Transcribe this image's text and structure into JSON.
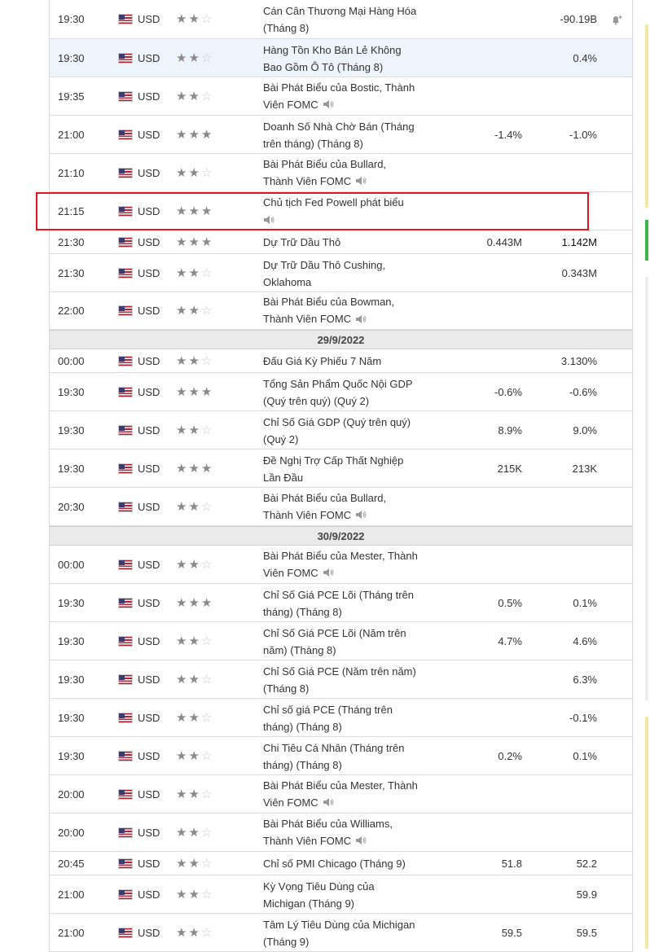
{
  "colors": {
    "highlight_border": "#e0191f",
    "date_row_bg": "#eaeaea",
    "highlight_row_bg": "#eef4fb"
  },
  "rows": [
    {
      "type": "event",
      "time": "19:30",
      "currency": "USD",
      "stars": 2,
      "event": "Cán Cân Thương Mại Hàng Hóa (Tháng 8)",
      "actual": "",
      "forecast": "-90.19B",
      "bell": true,
      "speaker": false
    },
    {
      "type": "event",
      "time": "19:30",
      "currency": "USD",
      "stars": 2,
      "event": "Hàng Tồn Kho Bán Lẻ Không Bao Gồm Ô Tô (Tháng 8)",
      "actual": "",
      "forecast": "0.4%",
      "highlight": true,
      "speaker": false
    },
    {
      "type": "event",
      "time": "19:35",
      "currency": "USD",
      "stars": 2,
      "event": "Bài Phát Biểu của Bostic, Thành Viên FOMC",
      "actual": "",
      "forecast": "",
      "speaker": true
    },
    {
      "type": "event",
      "time": "21:00",
      "currency": "USD",
      "stars": 3,
      "event": "Doanh Số Nhà Chờ Bán (Tháng trên tháng) (Tháng 8)",
      "actual": "-1.4%",
      "forecast": "-1.0%",
      "speaker": false
    },
    {
      "type": "event",
      "time": "21:10",
      "currency": "USD",
      "stars": 2,
      "event": "Bài Phát Biểu của Bullard, Thành Viên FOMC",
      "actual": "",
      "forecast": "",
      "speaker": true
    },
    {
      "type": "event",
      "time": "21:15",
      "currency": "USD",
      "stars": 3,
      "event": "Chủ tịch Fed Powell phát biểu",
      "actual": "",
      "forecast": "",
      "speaker": true,
      "speaker_newline": true
    },
    {
      "type": "event",
      "time": "21:30",
      "currency": "USD",
      "stars": 3,
      "event": "Dự Trữ Dầu Thô",
      "actual": "0.443M",
      "forecast": "1.142M",
      "speaker": false,
      "bold_forecast": true
    },
    {
      "type": "event",
      "time": "21:30",
      "currency": "USD",
      "stars": 2,
      "event": "Dự Trữ Dầu Thô Cushing, Oklahoma",
      "actual": "",
      "forecast": "0.343M",
      "speaker": false
    },
    {
      "type": "event",
      "time": "22:00",
      "currency": "USD",
      "stars": 2,
      "event": "Bài Phát Biểu của Bowman, Thành Viên FOMC",
      "actual": "",
      "forecast": "",
      "speaker": true
    },
    {
      "type": "date",
      "label": "29/9/2022"
    },
    {
      "type": "event",
      "time": "00:00",
      "currency": "USD",
      "stars": 2,
      "event": "Đấu Giá Kỳ Phiếu 7 Năm",
      "actual": "",
      "forecast": "3.130%",
      "speaker": false
    },
    {
      "type": "event",
      "time": "19:30",
      "currency": "USD",
      "stars": 3,
      "event": "Tổng Sản Phẩm Quốc Nội GDP (Quý trên quý) (Quý 2)",
      "actual": "-0.6%",
      "forecast": "-0.6%",
      "speaker": false
    },
    {
      "type": "event",
      "time": "19:30",
      "currency": "USD",
      "stars": 2,
      "event": "Chỉ Số Giá GDP (Quý trên quý) (Quý 2)",
      "actual": "8.9%",
      "forecast": "9.0%",
      "speaker": false
    },
    {
      "type": "event",
      "time": "19:30",
      "currency": "USD",
      "stars": 3,
      "event": "Đề Nghị Trợ Cấp Thất Nghiệp Lần Đầu",
      "actual": "215K",
      "forecast": "213K",
      "speaker": false
    },
    {
      "type": "event",
      "time": "20:30",
      "currency": "USD",
      "stars": 2,
      "event": "Bài Phát Biểu của Bullard, Thành Viên FOMC",
      "actual": "",
      "forecast": "",
      "speaker": true
    },
    {
      "type": "date",
      "label": "30/9/2022"
    },
    {
      "type": "event",
      "time": "00:00",
      "currency": "USD",
      "stars": 2,
      "event": "Bài Phát Biểu của Mester, Thành Viên FOMC",
      "actual": "",
      "forecast": "",
      "speaker": true
    },
    {
      "type": "event",
      "time": "19:30",
      "currency": "USD",
      "stars": 3,
      "event": "Chỉ Số Giá PCE Lõi (Tháng trên tháng) (Tháng 8)",
      "actual": "0.5%",
      "forecast": "0.1%",
      "speaker": false
    },
    {
      "type": "event",
      "time": "19:30",
      "currency": "USD",
      "stars": 2,
      "event": "Chỉ Số Giá PCE Lõi (Năm trên năm) (Tháng 8)",
      "actual": "4.7%",
      "forecast": "4.6%",
      "speaker": false
    },
    {
      "type": "event",
      "time": "19:30",
      "currency": "USD",
      "stars": 2,
      "event": "Chỉ Số Giá PCE (Năm trên năm) (Tháng 8)",
      "actual": "",
      "forecast": "6.3%",
      "speaker": false
    },
    {
      "type": "event",
      "time": "19:30",
      "currency": "USD",
      "stars": 2,
      "event": "Chỉ số giá PCE (Tháng trên tháng) (Tháng 8)",
      "actual": "",
      "forecast": "-0.1%",
      "speaker": false
    },
    {
      "type": "event",
      "time": "19:30",
      "currency": "USD",
      "stars": 2,
      "event": "Chi Tiêu Cá Nhân (Tháng trên tháng) (Tháng 8)",
      "actual": "0.2%",
      "forecast": "0.1%",
      "speaker": false
    },
    {
      "type": "event",
      "time": "20:00",
      "currency": "USD",
      "stars": 2,
      "event": "Bài Phát Biểu của Mester, Thành Viên FOMC",
      "actual": "",
      "forecast": "",
      "speaker": true
    },
    {
      "type": "event",
      "time": "20:00",
      "currency": "USD",
      "stars": 2,
      "event": "Bài Phát Biểu của Williams, Thành Viên FOMC",
      "actual": "",
      "forecast": "",
      "speaker": true
    },
    {
      "type": "event",
      "time": "20:45",
      "currency": "USD",
      "stars": 2,
      "event": "Chỉ số PMI Chicago (Tháng 9)",
      "actual": "51.8",
      "forecast": "52.2",
      "speaker": false
    },
    {
      "type": "event",
      "time": "21:00",
      "currency": "USD",
      "stars": 2,
      "event": "Kỳ Vọng Tiêu Dùng của Michigan (Tháng 9)",
      "actual": "",
      "forecast": "59.9",
      "speaker": false
    },
    {
      "type": "event",
      "time": "21:00",
      "currency": "USD",
      "stars": 2,
      "event": "Tâm Lý Tiêu Dùng của Michigan (Tháng 9)",
      "actual": "59.5",
      "forecast": "59.5",
      "speaker": false
    }
  ]
}
